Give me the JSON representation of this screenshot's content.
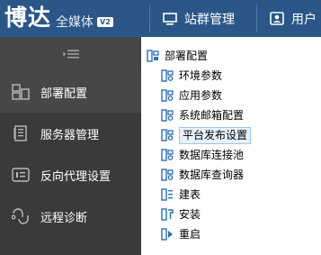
{
  "header": {
    "logo_text": "博达",
    "logo_subtitle": "全媒体",
    "version_badge": "V2",
    "nav": [
      {
        "label": "站群管理",
        "icon": "monitor-icon"
      },
      {
        "label": "用户",
        "icon": "user-icon"
      }
    ]
  },
  "sidebar": {
    "collapse_icon": "collapse-menu-icon",
    "items": [
      {
        "label": "部署配置",
        "icon": "deploy-config-icon",
        "active": true
      },
      {
        "label": "服务器管理",
        "icon": "server-icon",
        "active": false
      },
      {
        "label": "反向代理设置",
        "icon": "proxy-icon",
        "active": false
      },
      {
        "label": "远程诊断",
        "icon": "diagnose-icon",
        "active": false
      }
    ]
  },
  "tree": {
    "root": {
      "label": "部署配置",
      "icon": "tree-folder-icon"
    },
    "children": [
      {
        "label": "环境参数",
        "icon": "tree-config-icon"
      },
      {
        "label": "应用参数",
        "icon": "tree-config-icon"
      },
      {
        "label": "系统邮箱配置",
        "icon": "tree-config-icon"
      },
      {
        "label": "平台发布设置",
        "icon": "tree-config-icon",
        "selected": true
      },
      {
        "label": "数据库连接池",
        "icon": "tree-config-icon"
      },
      {
        "label": "数据库查询器",
        "icon": "tree-config-icon"
      },
      {
        "label": "建表",
        "icon": "tree-table-icon"
      },
      {
        "label": "安装",
        "icon": "tree-install-icon"
      },
      {
        "label": "重启",
        "icon": "tree-restart-icon"
      }
    ]
  },
  "colors": {
    "header_bg": "#2b5788",
    "sidebar_bg": "#3a3a3a",
    "sidebar_active_bg": "#474747",
    "tree_icon": "#2a6fb5",
    "selection_bg": "#e8f2fb",
    "selection_border": "#9dc4e8"
  }
}
